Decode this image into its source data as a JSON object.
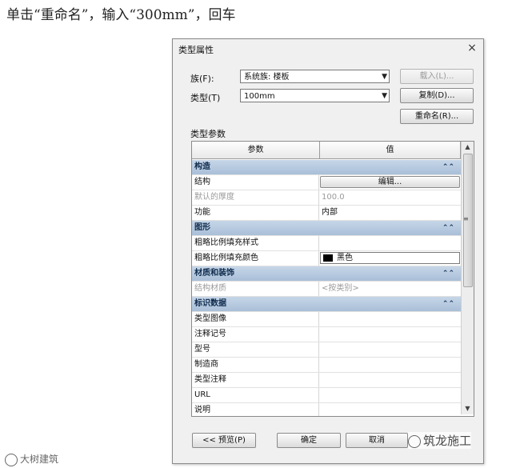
{
  "instruction": "单击“重命名”，输入“300mm”，回车",
  "dialog": {
    "title": "类型属性",
    "family_label": "族(F):",
    "family_value": "系统族: 楼板",
    "type_label": "类型(T)",
    "type_value": "100mm",
    "load_button": "载入(L)...",
    "duplicate_button": "复制(D)...",
    "rename_button": "重命名(R)...",
    "type_params_label": "类型参数",
    "grid": {
      "headers": [
        "参数",
        "值"
      ],
      "rows": [
        {
          "kind": "category",
          "param": "构造"
        },
        {
          "kind": "param",
          "param": "结构",
          "value": "编辑...",
          "control": "button"
        },
        {
          "kind": "param",
          "param": "默认的厚度",
          "value": "100.0",
          "grey": true
        },
        {
          "kind": "param",
          "param": "功能",
          "value": "内部"
        },
        {
          "kind": "category",
          "param": "图形"
        },
        {
          "kind": "param",
          "param": "粗略比例填充样式",
          "value": ""
        },
        {
          "kind": "param",
          "param": "粗略比例填充颜色",
          "value": "黑色",
          "control": "swatch"
        },
        {
          "kind": "category",
          "param": "材质和装饰"
        },
        {
          "kind": "param",
          "param": "结构材质",
          "value": "<按类别>",
          "grey": true
        },
        {
          "kind": "category",
          "param": "标识数据"
        },
        {
          "kind": "param",
          "param": "类型图像",
          "value": ""
        },
        {
          "kind": "param",
          "param": "注释记号",
          "value": ""
        },
        {
          "kind": "param",
          "param": "型号",
          "value": ""
        },
        {
          "kind": "param",
          "param": "制造商",
          "value": ""
        },
        {
          "kind": "param",
          "param": "类型注释",
          "value": ""
        },
        {
          "kind": "param",
          "param": "URL",
          "value": ""
        },
        {
          "kind": "param",
          "param": "说明",
          "value": ""
        }
      ]
    },
    "preview_button": "<< 预览(P)",
    "ok_button": "确定",
    "cancel_button": "取消",
    "close_glyph": "×",
    "collapse_glyph": "⌃⌃"
  },
  "watermark_left": "大树建筑",
  "watermark_right": "筑龙施工",
  "colors": {
    "category_band": "#b8cbe0",
    "swatch": "#000000"
  }
}
